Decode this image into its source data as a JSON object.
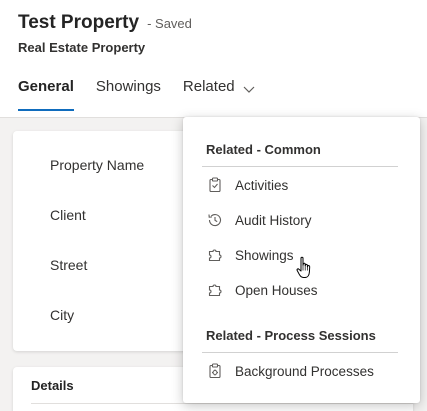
{
  "header": {
    "title": "Test Property",
    "status": "- Saved",
    "subtitle": "Real Estate Property"
  },
  "tabs": [
    {
      "label": "General",
      "active": true
    },
    {
      "label": "Showings",
      "active": false
    },
    {
      "label": "Related",
      "active": false,
      "icon": "chevron-down-icon"
    }
  ],
  "form": {
    "fields": [
      {
        "label": "Property Name"
      },
      {
        "label": "Client"
      },
      {
        "label": "Street"
      },
      {
        "label": "City"
      }
    ],
    "details_section_title": "Details"
  },
  "related_menu": {
    "groups": [
      {
        "header": "Related - Common",
        "items": [
          {
            "label": "Activities",
            "icon": "clipboard-icon"
          },
          {
            "label": "Audit History",
            "icon": "history-icon"
          },
          {
            "label": "Showings",
            "icon": "puzzle-icon"
          },
          {
            "label": "Open Houses",
            "icon": "puzzle-icon"
          }
        ]
      },
      {
        "header": "Related - Process Sessions",
        "items": [
          {
            "label": "Background Processes",
            "icon": "gear-doc-icon"
          }
        ]
      }
    ]
  },
  "colors": {
    "accent": "#0f6cbd",
    "page_background": "#f3f2f1",
    "text": "#242424"
  }
}
